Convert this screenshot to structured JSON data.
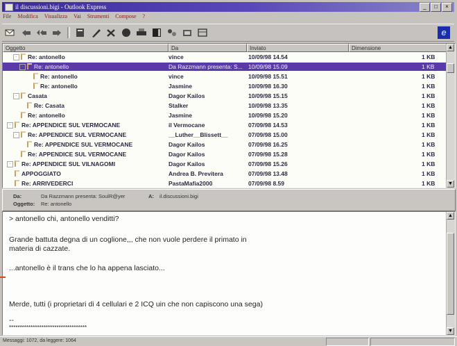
{
  "window": {
    "title": "il discussioni.bigi - Outlook Express",
    "buttons": [
      "_",
      "□",
      "×"
    ]
  },
  "menu": [
    "File",
    "Modifica",
    "Visualizza",
    "Vai",
    "Strumenti",
    "Compose",
    "?"
  ],
  "toolbar": {
    "icons": [
      "new-message-icon",
      "reply-icon",
      "reply-all-icon",
      "forward-icon",
      "newsgroups-icon",
      "edit-icon",
      "delete-icon",
      "stop-icon",
      "print-icon",
      "address-book-icon",
      "connect-icon",
      "disconnect-icon",
      "hang-up-icon"
    ],
    "logo": "e"
  },
  "list": {
    "columns": [
      "Oggetto",
      "Da",
      "Inviato",
      "Dimensione"
    ],
    "rows": [
      {
        "subject": "Re: antonello",
        "from": "vince",
        "sent": "10/09/98 14.54",
        "size": "1 KB",
        "indent": 1,
        "expander": "-"
      },
      {
        "subject": "Re: antonello",
        "from": "Da Razzmann presenta: S...",
        "sent": "10/09/98 15.09",
        "size": "1 KB",
        "indent": 2,
        "expander": "-",
        "selected": true
      },
      {
        "subject": "Re: antonello",
        "from": "vince",
        "sent": "10/09/98 15.51",
        "size": "1 KB",
        "indent": 3,
        "expander": ""
      },
      {
        "subject": "Re: antonello",
        "from": "Jasmine",
        "sent": "10/09/98 16.30",
        "size": "1 KB",
        "indent": 3,
        "expander": ""
      },
      {
        "subject": "Casata",
        "from": "Dagor Kailos",
        "sent": "10/09/98 15.15",
        "size": "1 KB",
        "indent": 1,
        "expander": "-"
      },
      {
        "subject": "Re: Casata",
        "from": "Stalker",
        "sent": "10/09/98 13.35",
        "size": "1 KB",
        "indent": 2,
        "expander": ""
      },
      {
        "subject": "Re: antonello",
        "from": "Jasmine",
        "sent": "10/09/98 15.20",
        "size": "1 KB",
        "indent": 1,
        "expander": ""
      },
      {
        "subject": "Re: APPENDICE SUL VERMOCANE",
        "from": "il Vermocane",
        "sent": "07/09/98 14.53",
        "size": "1 KB",
        "indent": 0,
        "expander": "-"
      },
      {
        "subject": "Re: APPENDICE SUL VERMOCANE",
        "from": "__Luther__Blissett__",
        "sent": "07/09/98 15.00",
        "size": "1 KB",
        "indent": 1,
        "expander": "-"
      },
      {
        "subject": "Re: APPENDICE SUL VERMOCANE",
        "from": "Dagor Kailos",
        "sent": "07/09/98 16.25",
        "size": "1 KB",
        "indent": 2,
        "expander": ""
      },
      {
        "subject": "Re: APPENDICE SUL VERMOCANE",
        "from": "Dagor Kailos",
        "sent": "07/09/98 15.28",
        "size": "1 KB",
        "indent": 1,
        "expander": ""
      },
      {
        "subject": "Re: APPENDICE SUL VILNAGOMI",
        "from": "Dagor Kailos",
        "sent": "07/09/98 15.26",
        "size": "1 KB",
        "indent": 0,
        "expander": "-"
      },
      {
        "subject": "APPOGGIATO",
        "from": "Andrea B. Previtera",
        "sent": "07/09/98 13.48",
        "size": "1 KB",
        "indent": 0,
        "expander": ""
      },
      {
        "subject": "Re: ARRIVEDERCI",
        "from": "PastaMafia2000",
        "sent": "07/09/98 8.59",
        "size": "1 KB",
        "indent": 0,
        "expander": ""
      }
    ]
  },
  "header": {
    "from_label": "Da:",
    "from_value": "Da Razzmann presenta: SoulR@yer",
    "to_label": "A:",
    "to_value": "il.discussioni.bigi",
    "subject_label": "Oggetto:",
    "subject_value": "Re: antonello"
  },
  "message": {
    "lines": [
      "> antonello chi, antonello venditti?",
      "Grande battuta degna di un coglione,,, che non vuole perdere il primato in",
      "materia di cazzate.",
      "...antonello è il trans che lo ha appena lasciato...",
      "Merde, tutti (i proprietari di 4 cellulari e 2 ICQ uin che non capiscono una sega)",
      "--",
      "************************************"
    ]
  },
  "status": {
    "text": "Messaggi: 1072, da leggere: 1064"
  }
}
